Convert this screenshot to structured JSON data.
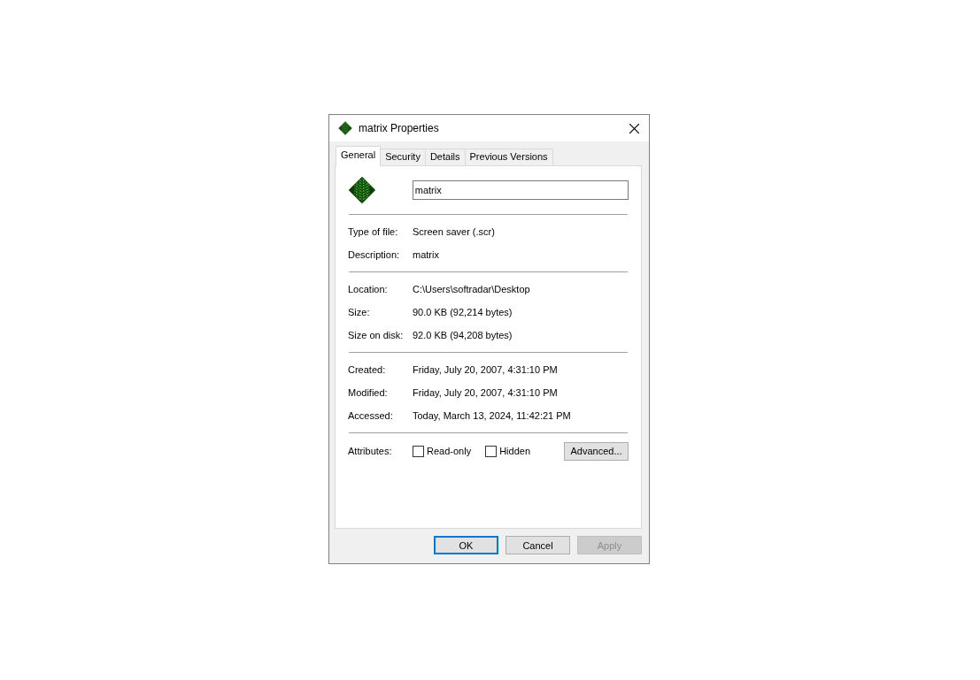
{
  "window": {
    "title": "matrix Properties"
  },
  "tabs": [
    {
      "label": "General",
      "selected": true
    },
    {
      "label": "Security",
      "selected": false
    },
    {
      "label": "Details",
      "selected": false
    },
    {
      "label": "Previous Versions",
      "selected": false
    }
  ],
  "name_field": {
    "value": "matrix"
  },
  "sections": [
    {
      "rows": [
        {
          "label": "Type of file:",
          "value": "Screen saver (.scr)"
        },
        {
          "label": "Description:",
          "value": "matrix"
        }
      ]
    },
    {
      "rows": [
        {
          "label": "Location:",
          "value": "C:\\Users\\softradar\\Desktop"
        },
        {
          "label": "Size:",
          "value": "90.0 KB (92,214 bytes)"
        },
        {
          "label": "Size on disk:",
          "value": "92.0 KB (94,208 bytes)"
        }
      ]
    },
    {
      "rows": [
        {
          "label": "Created:",
          "value": "Friday, July 20, 2007, 4:31:10 PM"
        },
        {
          "label": "Modified:",
          "value": "Friday, July 20, 2007, 4:31:10 PM"
        },
        {
          "label": "Accessed:",
          "value": "Today, March 13, 2024, 11:42:21 PM"
        }
      ]
    }
  ],
  "attributes": {
    "label": "Attributes:",
    "checkboxes": [
      {
        "label": "Read-only",
        "checked": false
      },
      {
        "label": "Hidden",
        "checked": false
      }
    ],
    "advanced_button": "Advanced..."
  },
  "buttons": [
    {
      "label": "OK",
      "default": true,
      "disabled": false
    },
    {
      "label": "Cancel",
      "default": false,
      "disabled": false
    },
    {
      "label": "Apply",
      "default": false,
      "disabled": true
    }
  ]
}
